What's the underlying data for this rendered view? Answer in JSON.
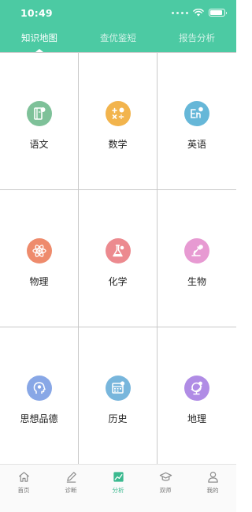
{
  "status": {
    "time": "10:49"
  },
  "tabs": [
    {
      "label": "知识地图",
      "active": true
    },
    {
      "label": "查优鉴短",
      "active": false
    },
    {
      "label": "报告分析",
      "active": false
    }
  ],
  "subjects": [
    {
      "label": "语文",
      "icon": "book-icon",
      "color": "#7ec199"
    },
    {
      "label": "数学",
      "icon": "math-symbols-icon",
      "color": "#f2b44d"
    },
    {
      "label": "英语",
      "icon": "english-letters-icon",
      "color": "#66b7d8"
    },
    {
      "label": "物理",
      "icon": "atom-icon",
      "color": "#ee8b6c"
    },
    {
      "label": "化学",
      "icon": "flask-icon",
      "color": "#ec8a8f"
    },
    {
      "label": "生物",
      "icon": "microscope-icon",
      "color": "#e79ad2"
    },
    {
      "label": "思想品德",
      "icon": "head-icon",
      "color": "#88a7e6"
    },
    {
      "label": "历史",
      "icon": "calendar-icon",
      "color": "#78b6dc"
    },
    {
      "label": "地理",
      "icon": "globe-icon",
      "color": "#b08ce5"
    }
  ],
  "bottom_nav": [
    {
      "label": "首页",
      "icon": "home-icon",
      "active": false
    },
    {
      "label": "诊断",
      "icon": "pencil-icon",
      "active": false
    },
    {
      "label": "分析",
      "icon": "chart-icon",
      "active": true
    },
    {
      "label": "双师",
      "icon": "graduation-cap-icon",
      "active": false
    },
    {
      "label": "我的",
      "icon": "user-icon",
      "active": false
    }
  ],
  "colors": {
    "header": "#4ccaa3",
    "accent": "#3bb98f"
  }
}
